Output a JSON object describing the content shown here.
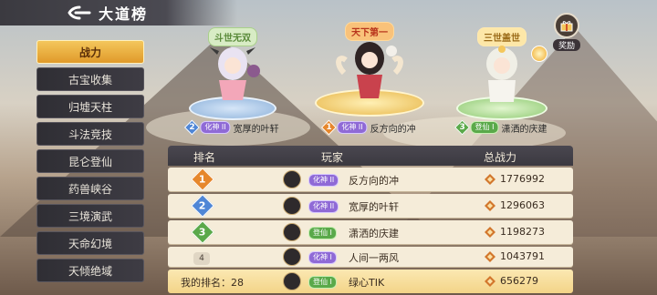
{
  "header": {
    "title": "大道榜"
  },
  "sidebar": {
    "items": [
      {
        "label": "战力",
        "active": true
      },
      {
        "label": "古宝收集",
        "active": false
      },
      {
        "label": "归墟天柱",
        "active": false
      },
      {
        "label": "斗法竞技",
        "active": false
      },
      {
        "label": "昆仑登仙",
        "active": false
      },
      {
        "label": "药兽峡谷",
        "active": false
      },
      {
        "label": "三境演武",
        "active": false
      },
      {
        "label": "天命幻境",
        "active": false
      },
      {
        "label": "天倾绝域",
        "active": false
      }
    ]
  },
  "reward": {
    "label": "奖励",
    "icon": "gift-icon"
  },
  "podium": {
    "first": {
      "rank": "1",
      "title": "天下第一",
      "realm": "化神 II",
      "name": "反方向的冲"
    },
    "second": {
      "rank": "2",
      "title": "斗世无双",
      "realm": "化神 II",
      "name": "宽厚的叶轩"
    },
    "third": {
      "rank": "3",
      "title": "三世盖世",
      "realm": "登仙 I",
      "name": "潇洒的庆建"
    }
  },
  "table": {
    "headers": {
      "rank": "排名",
      "player": "玩家",
      "power": "总战力"
    },
    "rows": [
      {
        "rank": "1",
        "realm": "化神 II",
        "name": "反方向的冲",
        "power": "1776992"
      },
      {
        "rank": "2",
        "realm": "化神 II",
        "name": "宽厚的叶轩",
        "power": "1296063"
      },
      {
        "rank": "3",
        "realm": "登仙 I",
        "name": "潇洒的庆建",
        "power": "1198273"
      },
      {
        "rank": "4",
        "realm": "化神 I",
        "name": "人间一两风",
        "power": "1043791"
      }
    ]
  },
  "me": {
    "label": "我的排名：28",
    "realm": "登仙 I",
    "name": "绿心TIK",
    "power": "656279"
  },
  "colors": {
    "accent": "#e09a2a",
    "gold": "#f4c75c",
    "rank1": "#e6872c",
    "rank2": "#4f86d6",
    "rank3": "#5aa94a"
  }
}
